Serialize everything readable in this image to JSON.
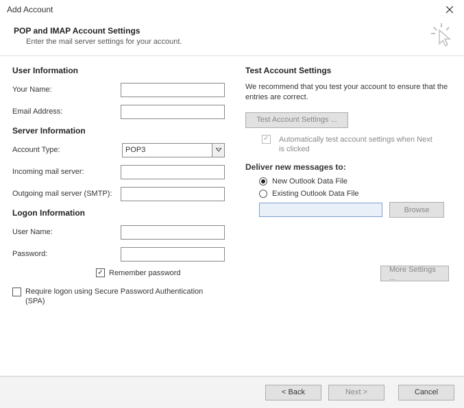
{
  "window": {
    "title": "Add Account"
  },
  "header": {
    "title": "POP and IMAP Account Settings",
    "subtitle": "Enter the mail server settings for your account."
  },
  "left": {
    "userInfoTitle": "User Information",
    "yourNameLabel": "Your Name:",
    "yourNameValue": "",
    "emailLabel": "Email Address:",
    "emailValue": "",
    "serverInfoTitle": "Server Information",
    "accountTypeLabel": "Account Type:",
    "accountTypeValue": "POP3",
    "incomingLabel": "Incoming mail server:",
    "incomingValue": "",
    "outgoingLabel": "Outgoing mail server (SMTP):",
    "outgoingValue": "",
    "logonInfoTitle": "Logon Information",
    "userNameLabel": "User Name:",
    "userNameValue": "",
    "passwordLabel": "Password:",
    "passwordValue": "",
    "rememberLabel": "Remember password",
    "spaLabel": "Require logon using Secure Password Authentication (SPA)"
  },
  "right": {
    "testTitle": "Test Account Settings",
    "testDesc": "We recommend that you test your account to ensure that the entries are correct.",
    "testButton": "Test Account Settings ...",
    "autoTestLabel": "Automatically test account settings when Next is clicked",
    "deliverTitle": "Deliver new messages to:",
    "newFileLabel": "New Outlook Data File",
    "existingFileLabel": "Existing Outlook Data File",
    "existingValue": "",
    "browseLabel": "Browse",
    "moreSettingsLabel": "More Settings ..."
  },
  "footer": {
    "back": "< Back",
    "next": "Next >",
    "cancel": "Cancel"
  }
}
